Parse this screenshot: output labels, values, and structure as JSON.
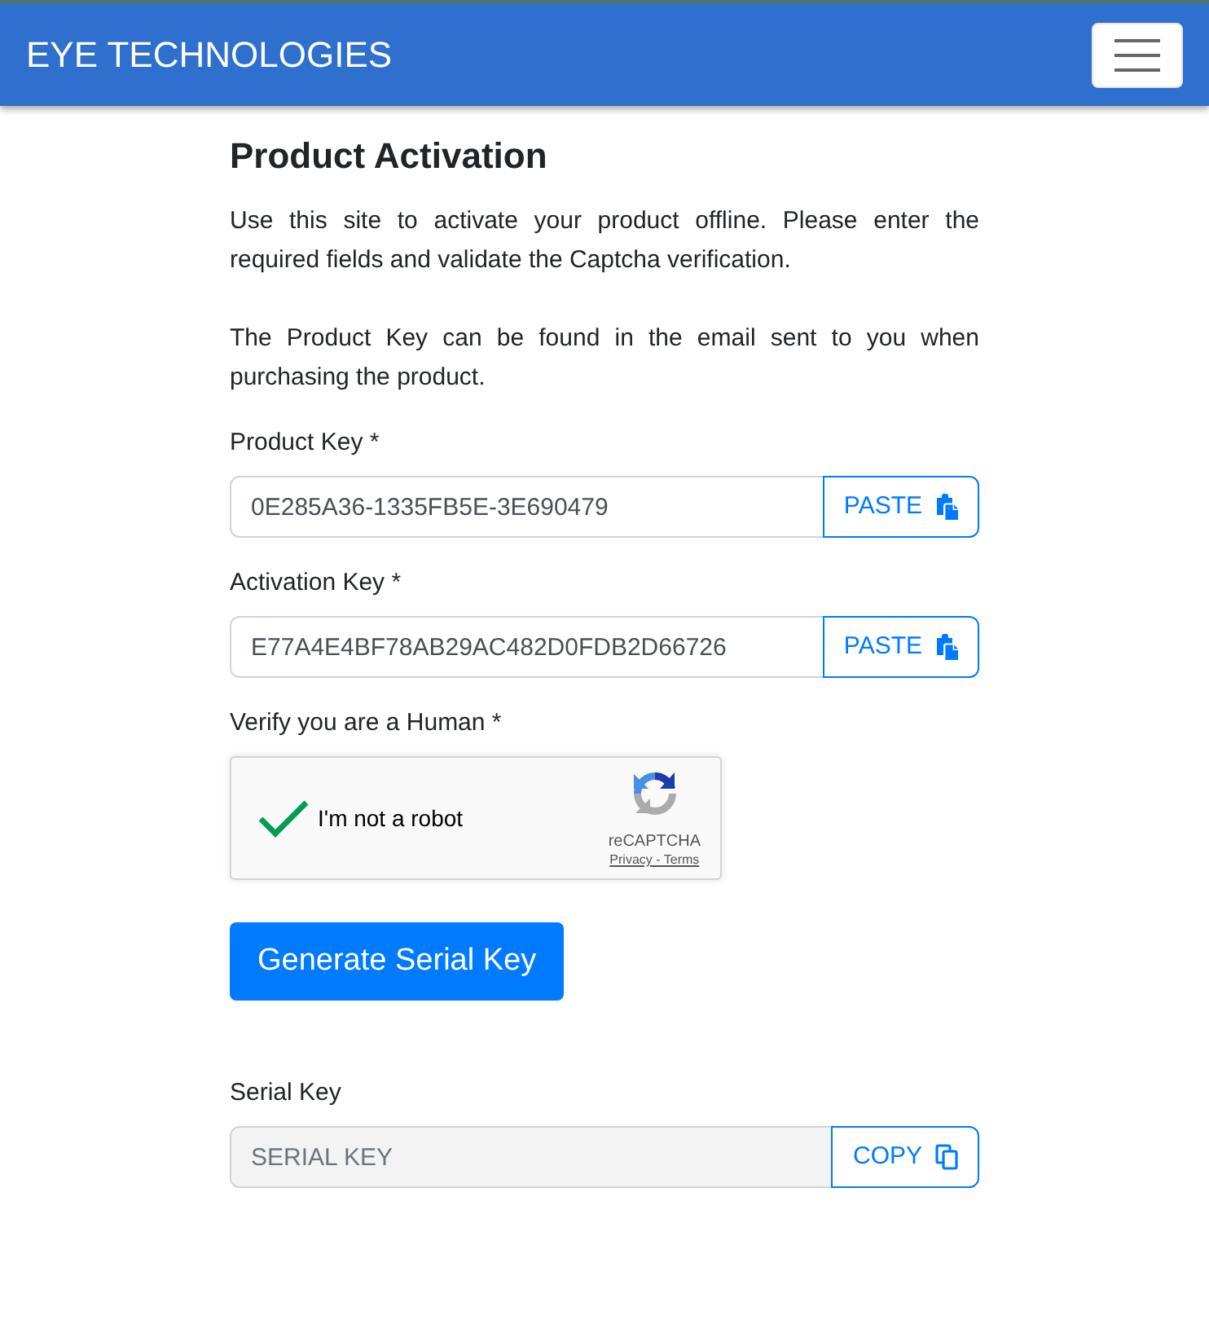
{
  "navbar": {
    "brand": "EYE TECHNOLOGIES"
  },
  "form": {
    "title": "Product Activation",
    "paragraphs": [
      "Use this site to activate your product offline. Please enter the required fields and validate the Captcha verification.",
      "The Product Key can be found in the email sent to you when purchasing the product."
    ],
    "fields": [
      {
        "label": "Product Key *",
        "value": "0E285A36-1335FB5E-3E690479",
        "button": {
          "label": "PASTE",
          "kind": "paste"
        }
      },
      {
        "label": "Activation Key *",
        "value": "E77A4E4BF78AB29AC482D0FDB2D66726",
        "button": {
          "label": "PASTE",
          "kind": "paste"
        }
      }
    ],
    "captcha": {
      "label": "Verify you are a Human *",
      "text": "I'm not a robot",
      "checked": true,
      "brand": "reCAPTCHA",
      "links": "Privacy - Terms"
    },
    "submit": "Generate Serial Key",
    "output": {
      "label": "Serial Key",
      "placeholder": "SERIAL KEY",
      "disabled": true,
      "button": {
        "label": "COPY",
        "kind": "copy"
      }
    }
  }
}
